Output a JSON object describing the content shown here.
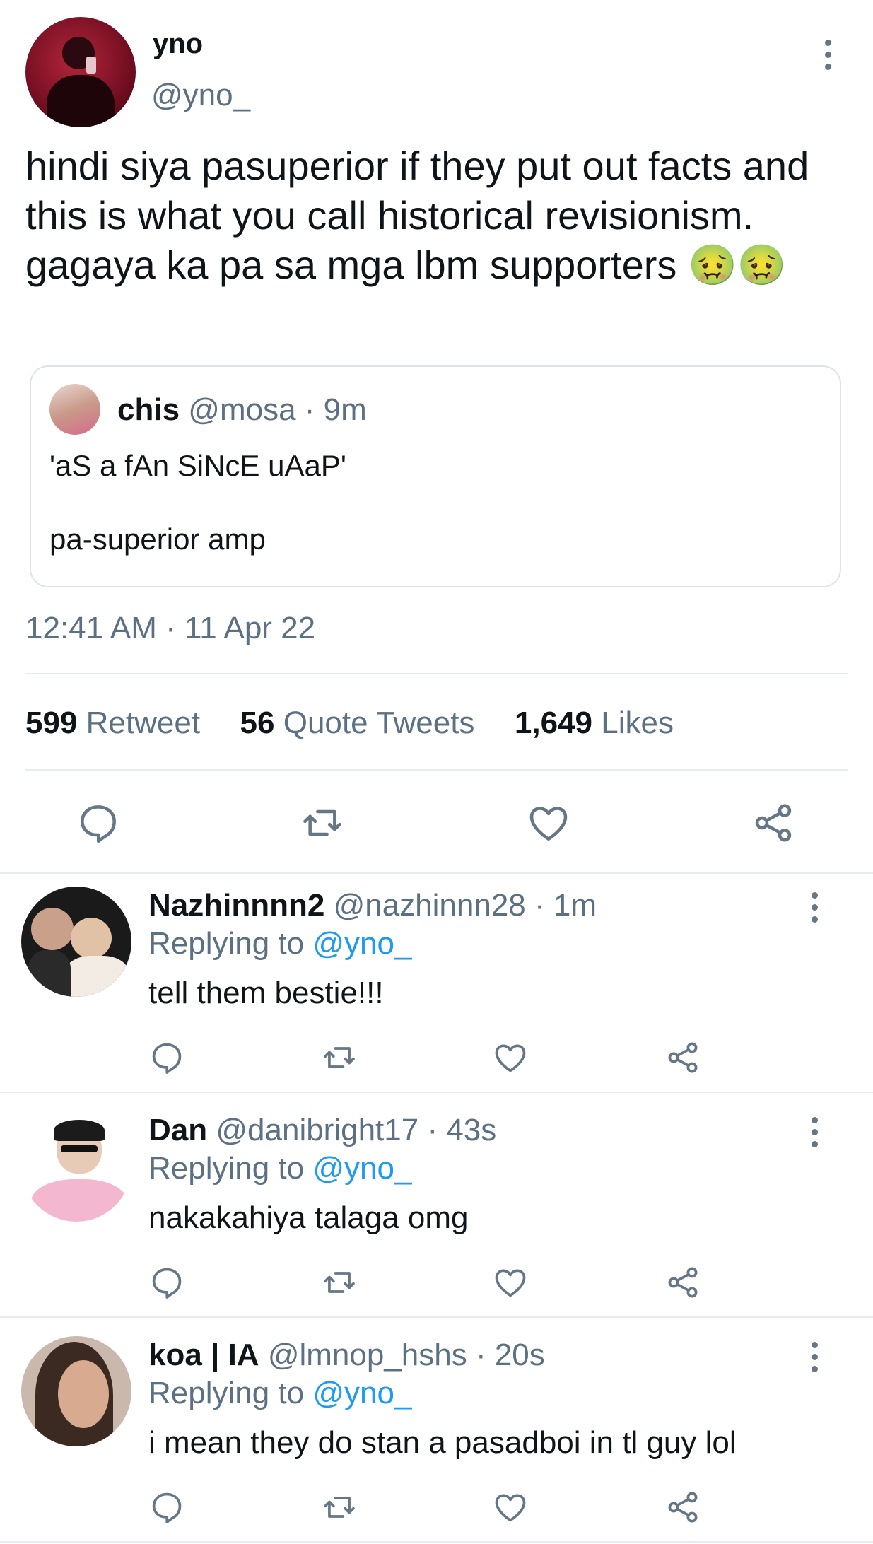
{
  "main_tweet": {
    "display_name": "yno",
    "handle": "@yno_",
    "text": "hindi siya pasuperior if they put out facts and this is what you call historical revisionism. gagaya ka pa sa mga lbm supporters",
    "emoji": "🤢🤢",
    "timestamp": "12:41 AM · 11 Apr 22",
    "quoted": {
      "display_name": "chis",
      "meta": "@mosa · 9m",
      "line1": "'aS a fAn SiNcE uAaP'",
      "line2": "pa-superior amp"
    },
    "stats": {
      "retweets": "599",
      "retweets_label": "Retweet",
      "quotes": "56",
      "quotes_label": "Quote Tweets",
      "likes": "1,649",
      "likes_label": "Likes"
    }
  },
  "replies": [
    {
      "display_name": "Nazhinnnn2",
      "meta": "@nazhinnn28 · 1m",
      "replying_label": "Replying to",
      "replying_to": "@yno_",
      "text": "tell them bestie!!!"
    },
    {
      "display_name": "Dan",
      "meta": "@danibright17 · 43s",
      "replying_label": "Replying to",
      "replying_to": "@yno_",
      "text": "nakakahiya talaga omg"
    },
    {
      "display_name": "koa | IA",
      "meta": "@lmnop_hshs · 20s",
      "replying_label": "Replying to",
      "replying_to": "@yno_",
      "text": "i mean they do stan a pasadboi in tl guy lol"
    }
  ],
  "colors": {
    "accent": "#1d9bf0",
    "muted": "#5b7083",
    "divider": "#e6ecf0",
    "icon": "#657786"
  },
  "icons": [
    "more-vertical-icon",
    "reply-icon",
    "retweet-icon",
    "like-icon",
    "share-icon"
  ]
}
